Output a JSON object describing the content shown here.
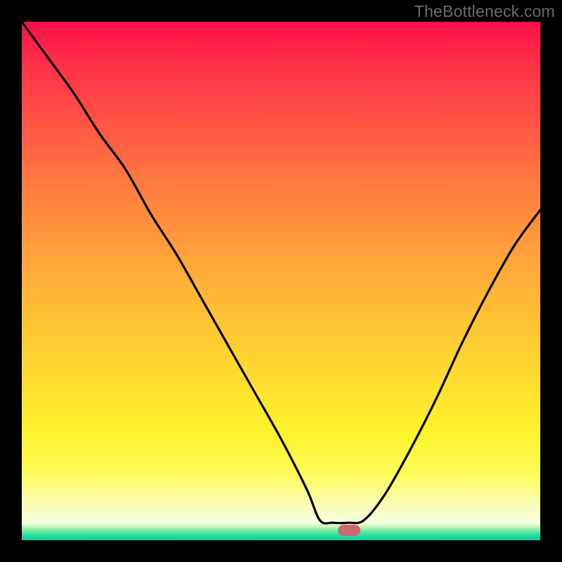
{
  "watermark": "TheBottleneck.com",
  "marker": {
    "x_frac": 0.632,
    "color": "#c86a6d"
  },
  "chart_data": {
    "type": "line",
    "title": "",
    "xlabel": "",
    "ylabel": "",
    "xlim": [
      0,
      1
    ],
    "ylim": [
      0,
      1
    ],
    "series": [
      {
        "name": "bottleneck-curve",
        "x": [
          0.0,
          0.05,
          0.1,
          0.15,
          0.2,
          0.25,
          0.3,
          0.35,
          0.4,
          0.45,
          0.5,
          0.55,
          0.575,
          0.6,
          0.63,
          0.66,
          0.7,
          0.75,
          0.8,
          0.85,
          0.9,
          0.95,
          1.0
        ],
        "y": [
          1.0,
          0.93,
          0.86,
          0.78,
          0.71,
          0.62,
          0.54,
          0.45,
          0.36,
          0.27,
          0.18,
          0.08,
          0.02,
          0.015,
          0.015,
          0.02,
          0.07,
          0.16,
          0.26,
          0.37,
          0.47,
          0.56,
          0.63
        ]
      }
    ],
    "background_gradient": [
      "#ff0f4a",
      "#ff5a44",
      "#ffa63a",
      "#ffde2f",
      "#fcfb57",
      "#f7ffe0",
      "#46e3a0",
      "#10d0a1"
    ],
    "optimum_marker": {
      "x": 0.632,
      "y": 0.015
    }
  }
}
